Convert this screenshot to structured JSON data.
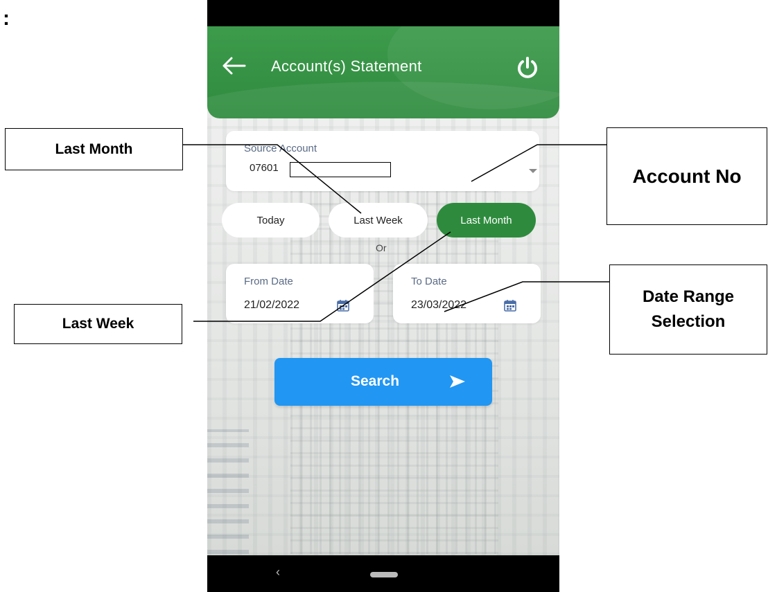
{
  "page": {
    "colon_mark": ":"
  },
  "header": {
    "title": "Account(s) Statement"
  },
  "source_account": {
    "label": "Source Account",
    "value": "07601"
  },
  "quick_range": {
    "today": "Today",
    "last_week": "Last Week",
    "last_month": "Last Month",
    "selected": "Last Month"
  },
  "separator": "Or",
  "from_date": {
    "label": "From Date",
    "value": "21/02/2022"
  },
  "to_date": {
    "label": "To Date",
    "value": "23/03/2022"
  },
  "search_button": {
    "label": "Search"
  },
  "colors": {
    "header_green": "#2f8b3e",
    "selected_pill": "#2e8b3d",
    "search_blue": "#2196f3"
  },
  "annotations": {
    "last_month": "Last Month",
    "last_week": "Last Week",
    "account_no": "Account No",
    "date_range": "Date Range Selection"
  }
}
